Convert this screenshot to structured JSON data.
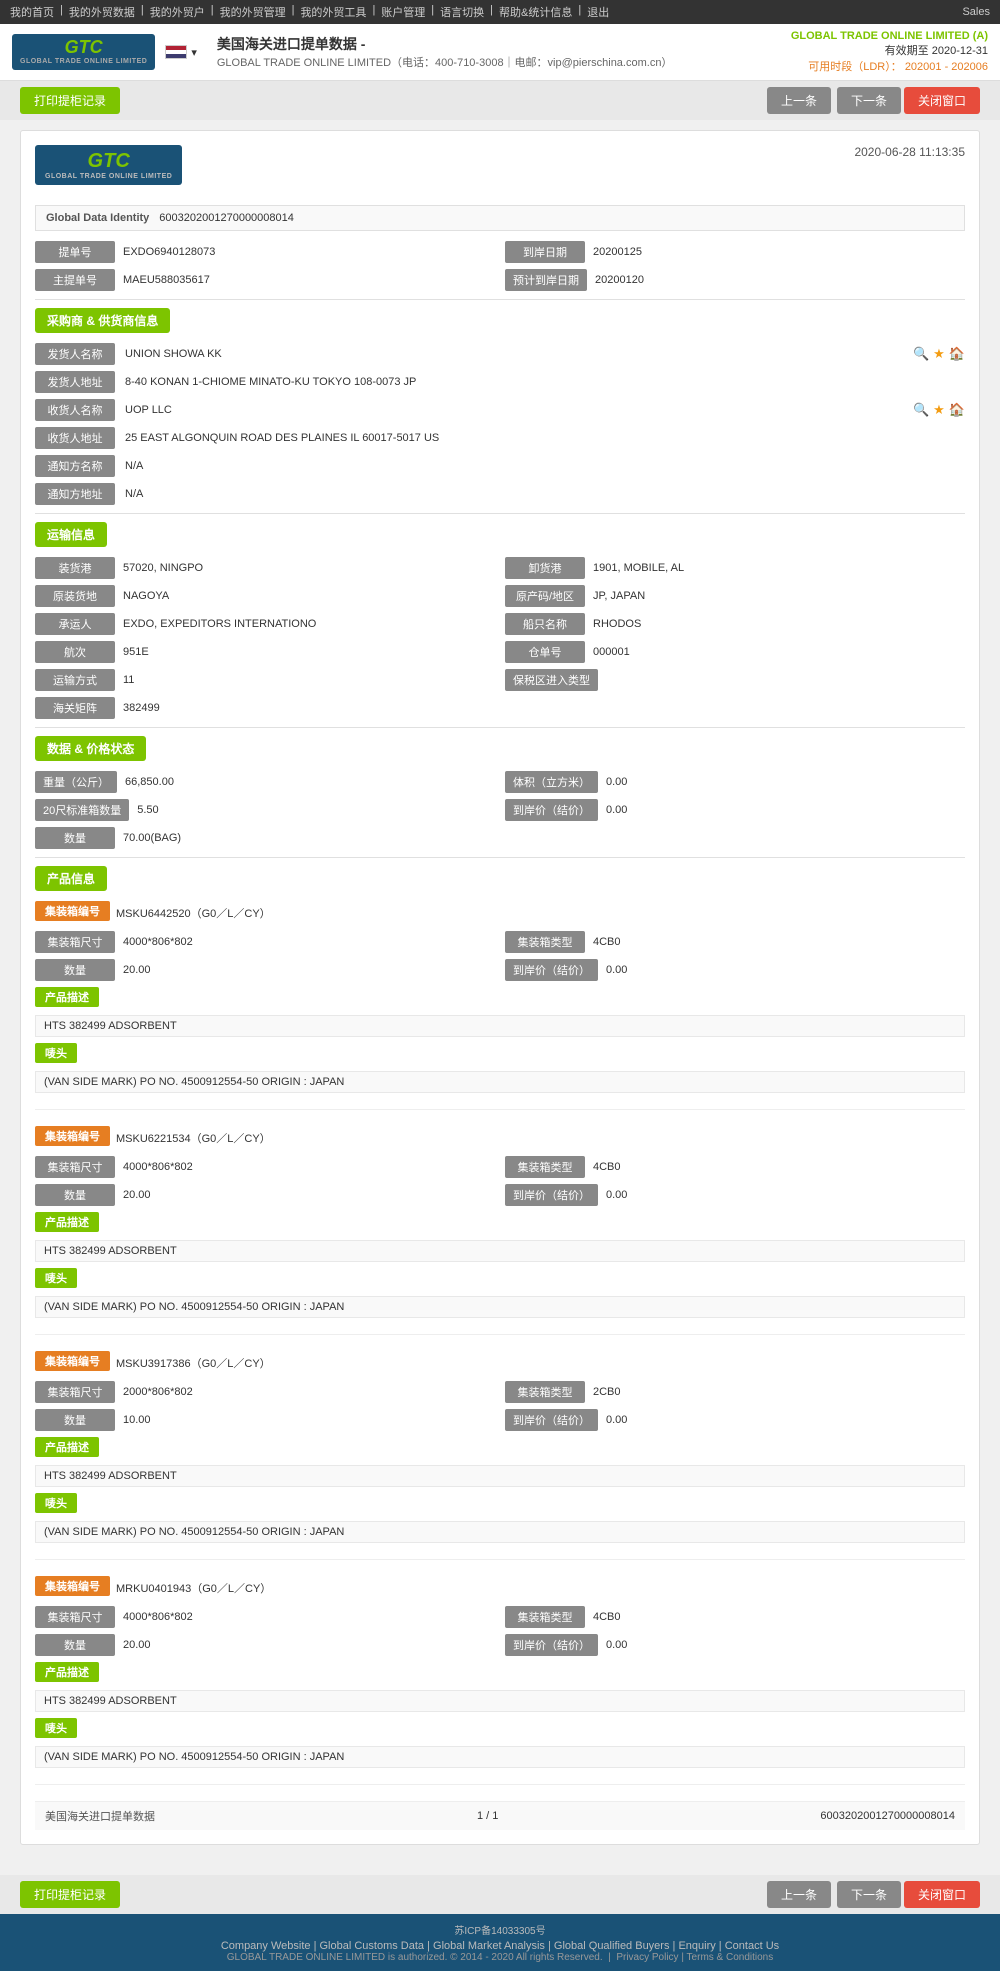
{
  "topnav": {
    "links": [
      "我的首页",
      "我的外贸数据",
      "我的外贸户",
      "我的外贸管理",
      "我的外贸工具",
      "账户管理",
      "语言切换",
      "帮助&统计信息",
      "退出"
    ],
    "sales": "Sales"
  },
  "header": {
    "logo_text": "GTC",
    "logo_sub": "GLOBAL TRADE ONLINE LIMITED",
    "flag_country": "US",
    "title": "美国海关进口提单数据 -",
    "company_line": "GLOBAL TRADE ONLINE LIMITED（电话：400-710-3008｜电邮：vip@pierschina.com.cn）",
    "right_company": "GLOBAL TRADE ONLINE LIMITED (A)",
    "right_validity_label": "有效期至",
    "right_validity": "2020-12-31",
    "right_quota_label": "可用时段（LDR）：",
    "right_quota": "202001 - 202006"
  },
  "toolbar": {
    "print_label": "打印提柜记录",
    "prev_label": "上一条",
    "next_label": "下一条",
    "close_label": "关闭窗口"
  },
  "record": {
    "date": "2020-06-28 11:13:35",
    "global_id_label": "Global Data Identity",
    "global_id_value": "6003202001270000008014",
    "fields": {
      "bill_no_label": "提单号",
      "bill_no_value": "EXDO6940128073",
      "arrive_date_label": "到岸日期",
      "arrive_date_value": "20200125",
      "master_no_label": "主提单号",
      "master_no_value": "MAEU588035617",
      "est_arrive_label": "预计到岸日期",
      "est_arrive_value": "20200120"
    },
    "section_shipper": "采购商 & 供货商信息",
    "shipper_name_label": "发货人名称",
    "shipper_name_value": "UNION SHOWA KK",
    "shipper_addr_label": "发货人地址",
    "shipper_addr_value": "8-40 KONAN 1-CHIOME MINATO-KU TOKYO 108-0073 JP",
    "consignee_name_label": "收货人名称",
    "consignee_name_value": "UOP LLC",
    "consignee_addr_label": "收货人地址",
    "consignee_addr_value": "25 EAST ALGONQUIN ROAD DES PLAINES IL 60017-5017 US",
    "notify_name_label": "通知方名称",
    "notify_name_value": "N/A",
    "notify_addr_label": "通知方地址",
    "notify_addr_value": "N/A",
    "section_shipping": "运输信息",
    "load_port_label": "装货港",
    "load_port_value": "57020, NINGPO",
    "dest_port_label": "卸货港",
    "dest_port_value": "1901, MOBILE, AL",
    "origin_place_label": "原装货地",
    "origin_place_value": "NAGOYA",
    "origin_region_label": "原产码/地区",
    "origin_region_value": "JP, JAPAN",
    "forwarder_label": "承运人",
    "forwarder_value": "EXDO, EXPEDITORS INTERNATIONO",
    "vessel_name_label": "船只名称",
    "vessel_name_value": "RHODOS",
    "voyage_label": "航次",
    "voyage_value": "951E",
    "bill_lading_label": "仓单号",
    "bill_lading_value": "000001",
    "transport_label": "运输方式",
    "transport_value": "11",
    "bonded_label": "保税区进入类型",
    "bonded_value": "",
    "customs_label": "海关矩阵",
    "customs_value": "382499",
    "section_data": "数据 & 价格状态",
    "weight_label": "重量（公斤）",
    "weight_value": "66,850.00",
    "volume_label": "体积（立方米）",
    "volume_value": "0.00",
    "container_20_label": "20尺标准箱数量",
    "container_20_value": "5.50",
    "unit_price_label": "到岸价（结价）",
    "unit_price_value": "0.00",
    "qty_label": "数量",
    "qty_value": "70.00(BAG)",
    "section_product": "产品信息",
    "containers": [
      {
        "tag_label": "集装箱编号",
        "tag_number": "MSKU6442520（G0／L／CY）",
        "size_label": "集装箱尺寸",
        "size_value": "4000*806*802",
        "type_label": "集装箱类型",
        "type_value": "4CB0",
        "qty_label": "数量",
        "qty_value": "20.00",
        "price_label": "到岸价（结价）",
        "price_value": "0.00",
        "desc_tag": "产品描述",
        "desc_value": "HTS 382499 ADSORBENT",
        "mark_tag": "唛头",
        "mark_value": "(VAN SIDE MARK) PO NO. 4500912554-50 ORIGIN : JAPAN"
      },
      {
        "tag_label": "集装箱编号",
        "tag_number": "MSKU6221534（G0／L／CY）",
        "size_label": "集装箱尺寸",
        "size_value": "4000*806*802",
        "type_label": "集装箱类型",
        "type_value": "4CB0",
        "qty_label": "数量",
        "qty_value": "20.00",
        "price_label": "到岸价（结价）",
        "price_value": "0.00",
        "desc_tag": "产品描述",
        "desc_value": "HTS 382499 ADSORBENT",
        "mark_tag": "唛头",
        "mark_value": "(VAN SIDE MARK) PO NO. 4500912554-50 ORIGIN : JAPAN"
      },
      {
        "tag_label": "集装箱编号",
        "tag_number": "MSKU3917386（G0／L／CY）",
        "size_label": "集装箱尺寸",
        "size_value": "2000*806*802",
        "type_label": "集装箱类型",
        "type_value": "2CB0",
        "qty_label": "数量",
        "qty_value": "10.00",
        "price_label": "到岸价（结价）",
        "price_value": "0.00",
        "desc_tag": "产品描述",
        "desc_value": "HTS 382499 ADSORBENT",
        "mark_tag": "唛头",
        "mark_value": "(VAN SIDE MARK) PO NO. 4500912554-50 ORIGIN : JAPAN"
      },
      {
        "tag_label": "集装箱编号",
        "tag_number": "MRKU0401943（G0／L／CY）",
        "size_label": "集装箱尺寸",
        "size_value": "4000*806*802",
        "type_label": "集装箱类型",
        "type_value": "4CB0",
        "qty_label": "数量",
        "qty_value": "20.00",
        "price_label": "到岸价（结价）",
        "price_value": "0.00",
        "desc_tag": "产品描述",
        "desc_value": "HTS 382499 ADSORBENT",
        "mark_tag": "唛头",
        "mark_value": "(VAN SIDE MARK) PO NO. 4500912554-50 ORIGIN : JAPAN"
      }
    ],
    "footer_label": "美国海关进口提单数据",
    "footer_page": "1 / 1",
    "footer_id": "6003202001270000008014"
  },
  "bottom_toolbar": {
    "print_label": "打印提柜记录",
    "prev_label": "上一条",
    "next_label": "下一条",
    "close_label": "关闭窗口"
  },
  "site_footer": {
    "icp": "苏ICP备14033305号",
    "links": [
      "Company Website",
      "Global Customs Data",
      "Global Market Analysis",
      "Global Qualified Buyers",
      "Enquiry",
      "Contact Us"
    ],
    "copyright": "GLOBAL TRADE ONLINE LIMITED is authorized. © 2014 - 2020 All rights Reserved.",
    "legal_links": [
      "Privacy Policy",
      "Terms & Conditions"
    ]
  }
}
